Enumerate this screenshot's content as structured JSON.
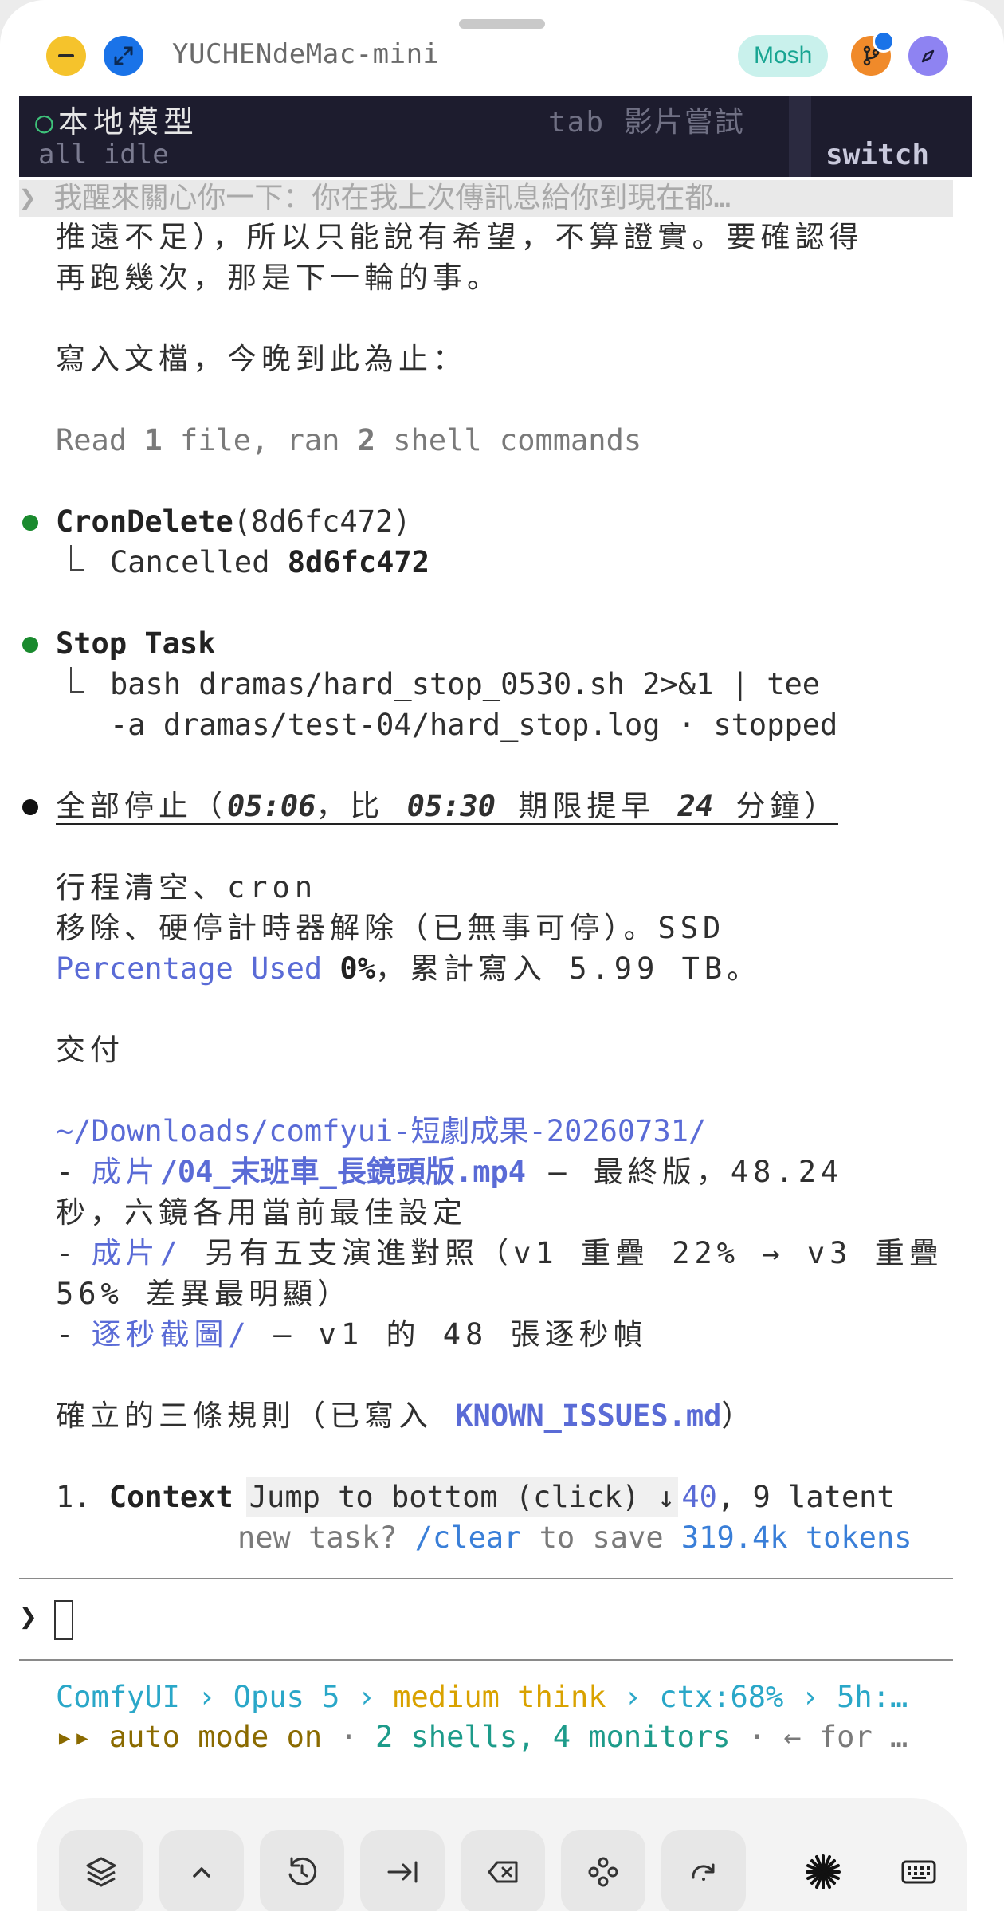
{
  "window": {
    "host": "YUCHENdeMac-mini",
    "mosh_label": "Mosh"
  },
  "tmux": {
    "session_marker": "○",
    "session_name": "本地模型",
    "hint": "tab 影片嘗試",
    "status": "all idle",
    "switch_label": "switch"
  },
  "prompt_preview": "❯ 我醒來關心你一下：你在我上次傳訊息給你到現在都…",
  "transcript": {
    "l1": "推遠不足），所以只能說有希望，不算證實。要確認得",
    "l2": "再跑幾次，那是下一輪的事。",
    "l3": "寫入文檔，今晚到此為止：",
    "read_a": "Read ",
    "read_n1": "1",
    "read_b": " file, ran ",
    "read_n2": "2",
    "read_c": " shell commands",
    "cron_tool": "CronDelete",
    "cron_arg": "(8d6fc472)",
    "cron_res_a": "Cancelled ",
    "cron_res_b": "8d6fc472",
    "stop_tool": "Stop Task",
    "stop_l1": "bash dramas/hard_stop_0530.sh 2>&1 | tee",
    "stop_l2": "-a dramas/test-04/hard_stop.log · stopped",
    "h_a": "全部停止（",
    "h_t1": "05:06",
    "h_b": "，比 ",
    "h_t2": "05:30",
    "h_c": " 期限提早 ",
    "h_n": "24",
    "h_d": " 分鐘）",
    "p1": "行程清空、cron",
    "p2": "移除、硬停計時器解除（已無事可停）。SSD",
    "p3_link": "Percentage Used",
    "p3_val": " 0%",
    "p3_rest": "，累計寫入 5.99 TB。",
    "deliver": "交付",
    "path": "~/Downloads/comfyui-短劇成果-20260731/",
    "i1_dash": "- ",
    "i1_link": "成片",
    "i1_file": "/04_末班車_長鏡頭版.mp4",
    "i1_rest": " — 最終版，48.24",
    "i1_cont": "秒，六鏡各用當前最佳設定",
    "i2_dash": "- ",
    "i2_link": "成片/",
    "i2_rest": " 另有五支演進對照（v1 重疊 22% → v3 重疊",
    "i2_cont": "56% 差異最明顯）",
    "i3_dash": "- ",
    "i3_link": "逐秒截圖/",
    "i3_rest": " — v1 的 48 張逐秒幀",
    "rules_a": "確立的三條規則（已寫入 ",
    "rules_file": "KNOWN_ISSUES.md",
    "rules_b": "）",
    "ctx_num": "1. ",
    "ctx_word": "Context",
    "jump": "Jump to bottom (click) ↓",
    "ctx_num2": "40",
    "ctx_rest": ", 9 latent",
    "tip_a": "new task? ",
    "tip_cmd": "/clear",
    "tip_b": " to save ",
    "tip_tokens": "319.4k tokens"
  },
  "input": {
    "chevron": "❯"
  },
  "statusline": {
    "app": "ComfyUI",
    "sep1": " › ",
    "model": "Opus 5",
    "sep2": " › ",
    "think": "medium think",
    "sep3": " › ",
    "ctx": "ctx:68%",
    "sep4": " › ",
    "limit": "5h:…",
    "mode_icon": "▸▸",
    "mode": " auto mode on",
    "dot1": " · ",
    "shells": "2 shells, 4 monitors",
    "dot2": " · ",
    "hint": "← for …"
  },
  "toolbar": {
    "icons": [
      "layers-icon",
      "chevron-up-icon",
      "history-icon",
      "tab-icon",
      "backspace-icon",
      "gamepad-icon",
      "redo-icon",
      "claude-spark-icon",
      "keyboard-icon"
    ]
  },
  "colors": {
    "tmux_bg": "#1d1c2e",
    "link": "#5a6bd6",
    "success_dot": "#1a8a2e",
    "mosh_pill": "#c9f1ec"
  }
}
